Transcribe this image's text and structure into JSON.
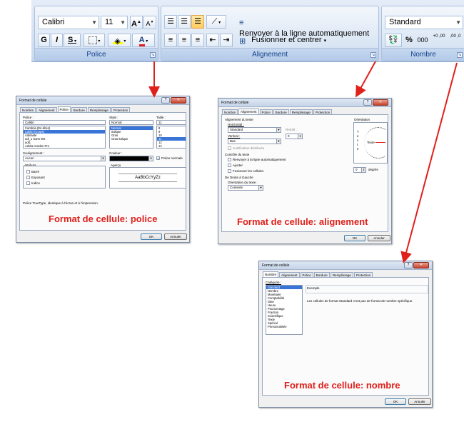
{
  "ribbon": {
    "police": {
      "font_name": "Calibri",
      "font_size": "11",
      "grow_label": "A",
      "shrink_label": "A",
      "bold_label": "G",
      "italic_label": "I",
      "underline_label": "S",
      "font_color_label": "A",
      "group_label": "Police"
    },
    "alignement": {
      "wrap_label": "Renvoyer à la ligne automatiquement",
      "merge_label": "Fusionner et centrer",
      "group_label": "Alignement"
    },
    "nombre": {
      "format_value": "Standard",
      "percent_label": "%",
      "thousands_label": "000",
      "inc_decimal_label": "+0 ,00",
      "dec_decimal_label": ",00 ,0",
      "group_label": "Nombre"
    }
  },
  "dialog_police": {
    "title": "Format de cellule",
    "tabs": [
      "Nombre",
      "Alignement",
      "Police",
      "Bordure",
      "Remplissage",
      "Protection"
    ],
    "police_label": "Police :",
    "police_value": "Calibri",
    "police_list": [
      "Cambria (En-têtes)",
      "Calibri (Corps)",
      "Adelaide",
      "adi_1 Sans MS",
      "adi1",
      "Adobe Caslon Pro"
    ],
    "style_label": "Style :",
    "style_value": "Normal",
    "style_list": [
      "Normal",
      "Italique",
      "Gras",
      "Gras italique"
    ],
    "taille_label": "Taille :",
    "taille_value": "11",
    "taille_list": [
      "8",
      "9",
      "10",
      "11",
      "12",
      "14"
    ],
    "soulignement_label": "Soulignement :",
    "soulignement_value": "Aucun",
    "couleur_label": "Couleur :",
    "police_normale_label": "Police normale",
    "attributs_label": "Attributs",
    "attributs": [
      "Barré",
      "Exposant",
      "Indice"
    ],
    "apercu_label": "Aperçu",
    "apercu_text": "AaBbCcYyZz",
    "note": "Police TrueType, identique à l'écran et à l'impression.",
    "ok_label": "OK",
    "cancel_label": "Annuler",
    "caption": "Format de cellule: police"
  },
  "dialog_alignement": {
    "title": "Format de cellule",
    "tabs": [
      "Nombre",
      "Alignement",
      "Police",
      "Bordure",
      "Remplissage",
      "Protection"
    ],
    "section_alignement": "Alignement du texte",
    "horizontal_label": "Horizontal :",
    "horizontal_value": "Standard",
    "retrait_label": "Retrait :",
    "retrait_value": "0",
    "vertical_label": "Vertical :",
    "vertical_value": "Bas",
    "justification_label": "Justification distribuée",
    "section_controle": "Contrôle du texte",
    "controle_options": [
      "Renvoyer à la ligne automatiquement",
      "Ajuster",
      "Fusionner les cellules"
    ],
    "section_droite": "De Droite à Gauche",
    "orientation_texte_label": "Orientation du texte :",
    "orientation_texte_value": "Contexte",
    "orientation_label": "Orientation",
    "vertical_text": "T e x t e",
    "texte_label": "Texte",
    "degres_value": "0",
    "degres_label": "degrés",
    "ok_label": "OK",
    "cancel_label": "Annuler",
    "caption": "Format de cellule: alignement"
  },
  "dialog_nombre": {
    "title": "Format de cellule",
    "tabs": [
      "Nombre",
      "Alignement",
      "Police",
      "Bordure",
      "Remplissage",
      "Protection"
    ],
    "categorie_label": "Catégorie :",
    "categories": [
      "Standard",
      "Nombre",
      "Monétaire",
      "Comptabilité",
      "Date",
      "Heure",
      "Pourcentage",
      "Fraction",
      "Scientifique",
      "Texte",
      "Spécial",
      "Personnalisée"
    ],
    "exemple_label": "Exemple",
    "description": "Les cellules de format Standard n'ont pas de format de nombre spécifique.",
    "ok_label": "OK",
    "cancel_label": "Annuler",
    "caption": "Format de cellule: nombre"
  },
  "colors": {
    "arrow": "#e0201b",
    "caption": "#e0201b",
    "ribbon_label": "#15428b",
    "selection": "#3875d7"
  }
}
